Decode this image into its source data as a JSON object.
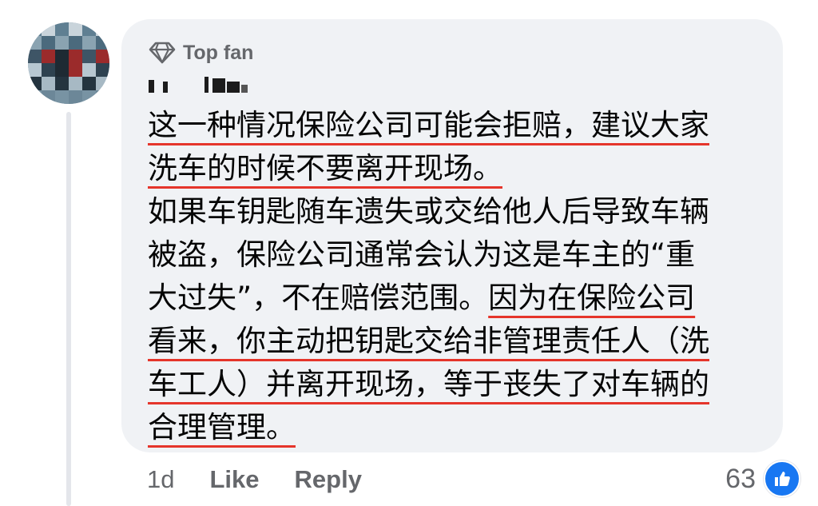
{
  "comment": {
    "badge_label": "Top fan",
    "badge_icon": "diamond-icon",
    "lines": [
      [
        {
          "text": "这一种情况保险公司可能会拒赔，建议大家",
          "underline": true
        }
      ],
      [
        {
          "text": "洗车的时候不要离开现场。",
          "underline": true
        }
      ],
      [
        {
          "text": "如果车钥匙随车遗失或交给他人后导致车辆",
          "underline": false
        }
      ],
      [
        {
          "text": "被盗，保险公司通常会认为这是车主的“重",
          "underline": false
        }
      ],
      [
        {
          "text": "大过失”，不在赔偿范围。",
          "underline": false
        },
        {
          "text": "因为在保险公司",
          "underline": true
        }
      ],
      [
        {
          "text": "看来，你主动把钥匙交给非管理责任人（洗",
          "underline": true
        }
      ],
      [
        {
          "text": "车工人）并离开现场，等于丧失了对车辆的",
          "underline": true
        }
      ],
      [
        {
          "text": "合理管理。",
          "underline": true
        }
      ]
    ],
    "underline_color": "#e5352b"
  },
  "actions": {
    "time": "1d",
    "like_label": "Like",
    "reply_label": "Reply"
  },
  "reactions": {
    "count": "63",
    "icon": "thumbs-up-icon",
    "color": "#1877f2"
  }
}
